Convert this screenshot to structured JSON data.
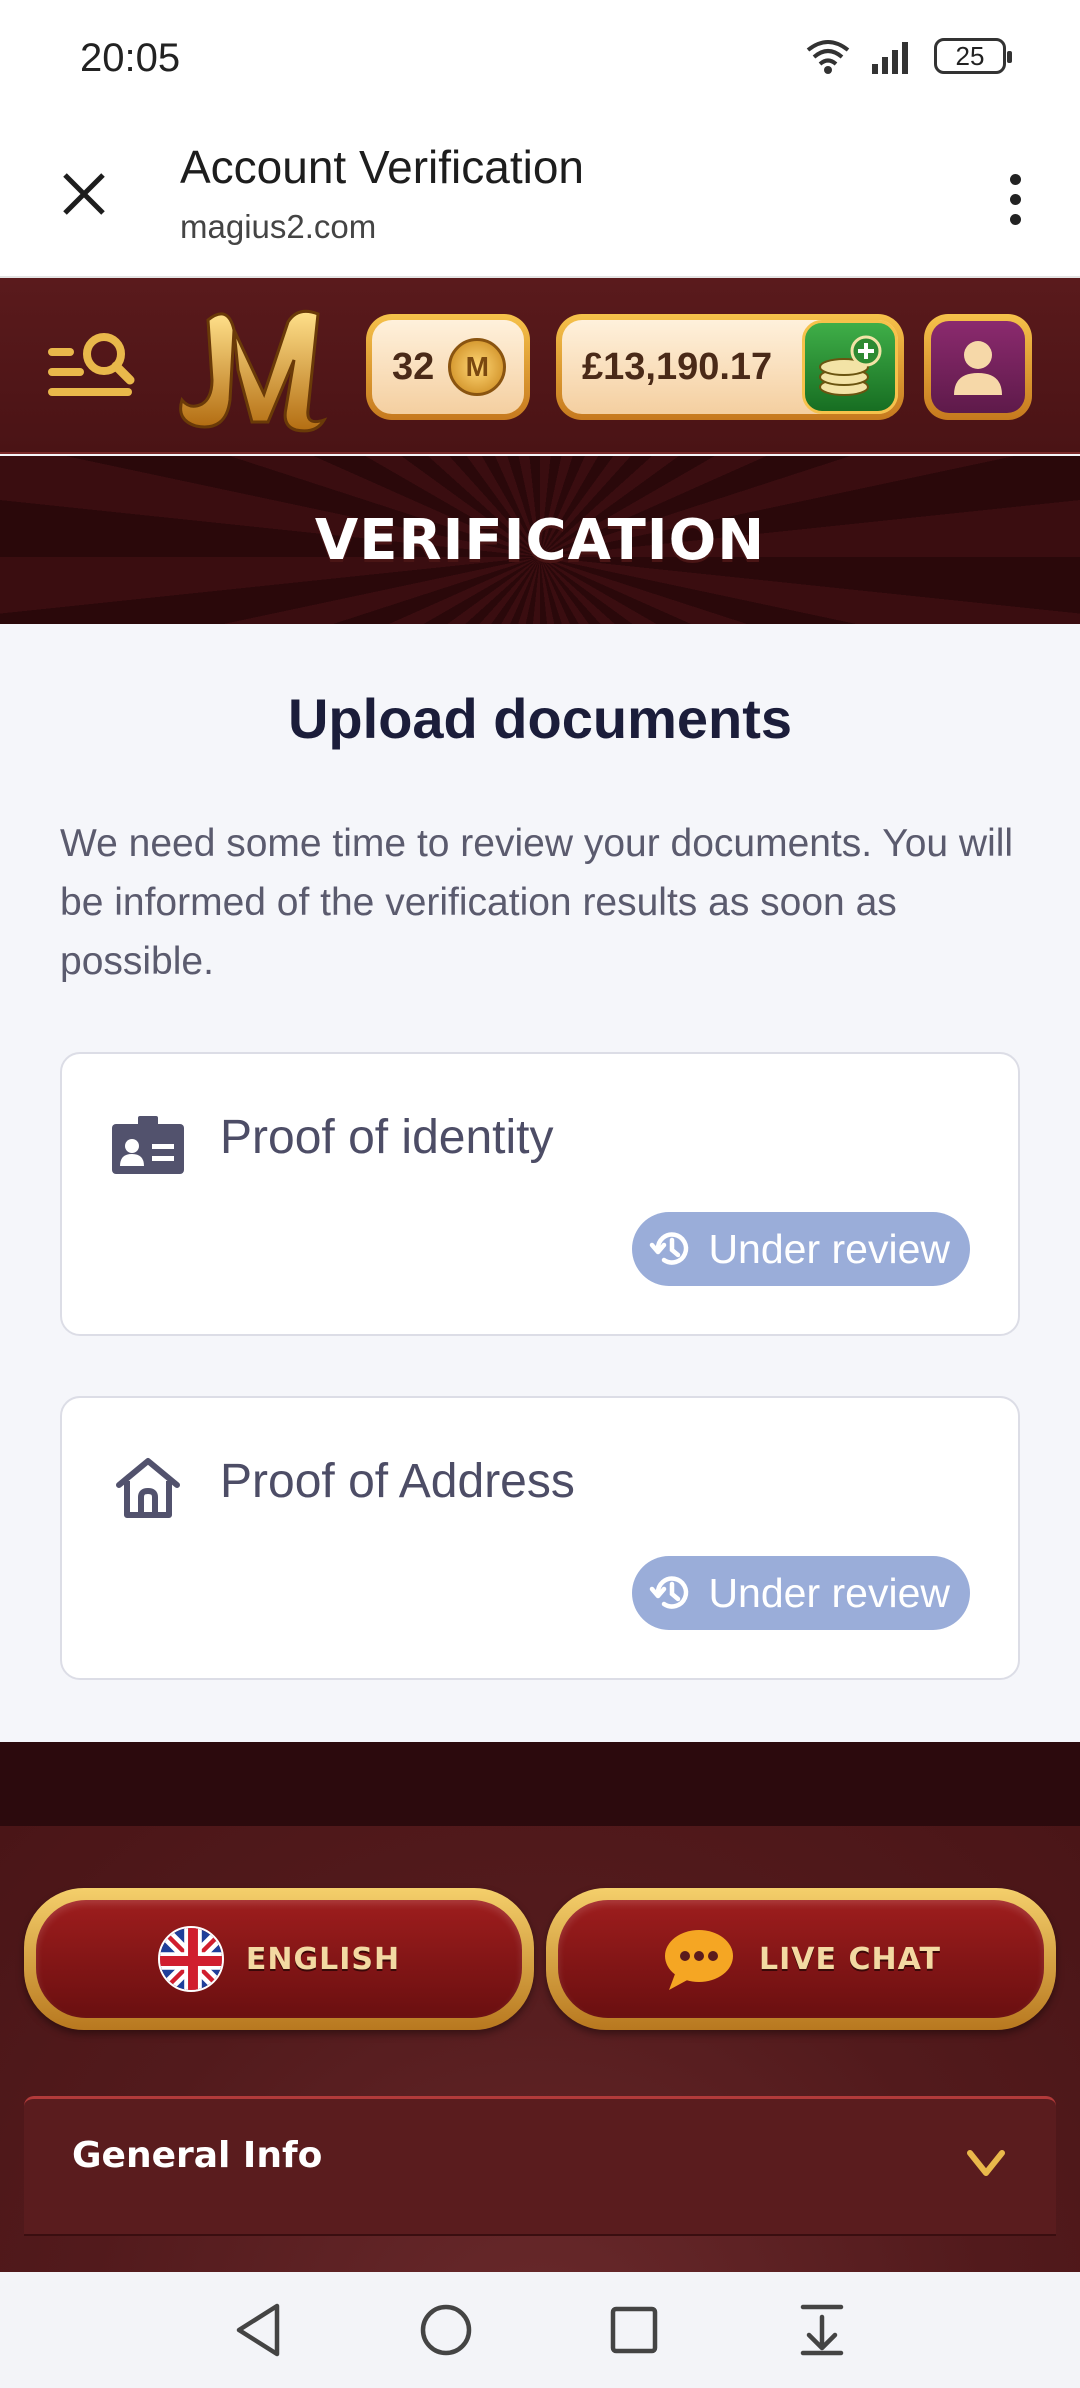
{
  "status_bar": {
    "time": "20:05",
    "battery": "25"
  },
  "browser_tab": {
    "title": "Account Verification",
    "url": "magius2.com"
  },
  "header": {
    "coins": "32",
    "coin_symbol": "M",
    "balance": "£13,190.17"
  },
  "banner": {
    "title": "VERIFICATION"
  },
  "main": {
    "heading": "Upload documents",
    "description": "We need some time to review your documents. You will be informed of the verification results as soon as possible.",
    "documents": [
      {
        "label": "Proof of identity",
        "icon": "id-card-icon",
        "status": "Under review"
      },
      {
        "label": "Proof of Address",
        "icon": "house-icon",
        "status": "Under review"
      }
    ]
  },
  "footer": {
    "language_button": "ENGLISH",
    "chat_button": "LIVE CHAT",
    "accordion_label": "General Info"
  },
  "colors": {
    "header_bg": "#5a1a1c",
    "review_badge": "#9aadd9",
    "gold": "#f6c24b",
    "heading_text": "#1b1d3a"
  }
}
